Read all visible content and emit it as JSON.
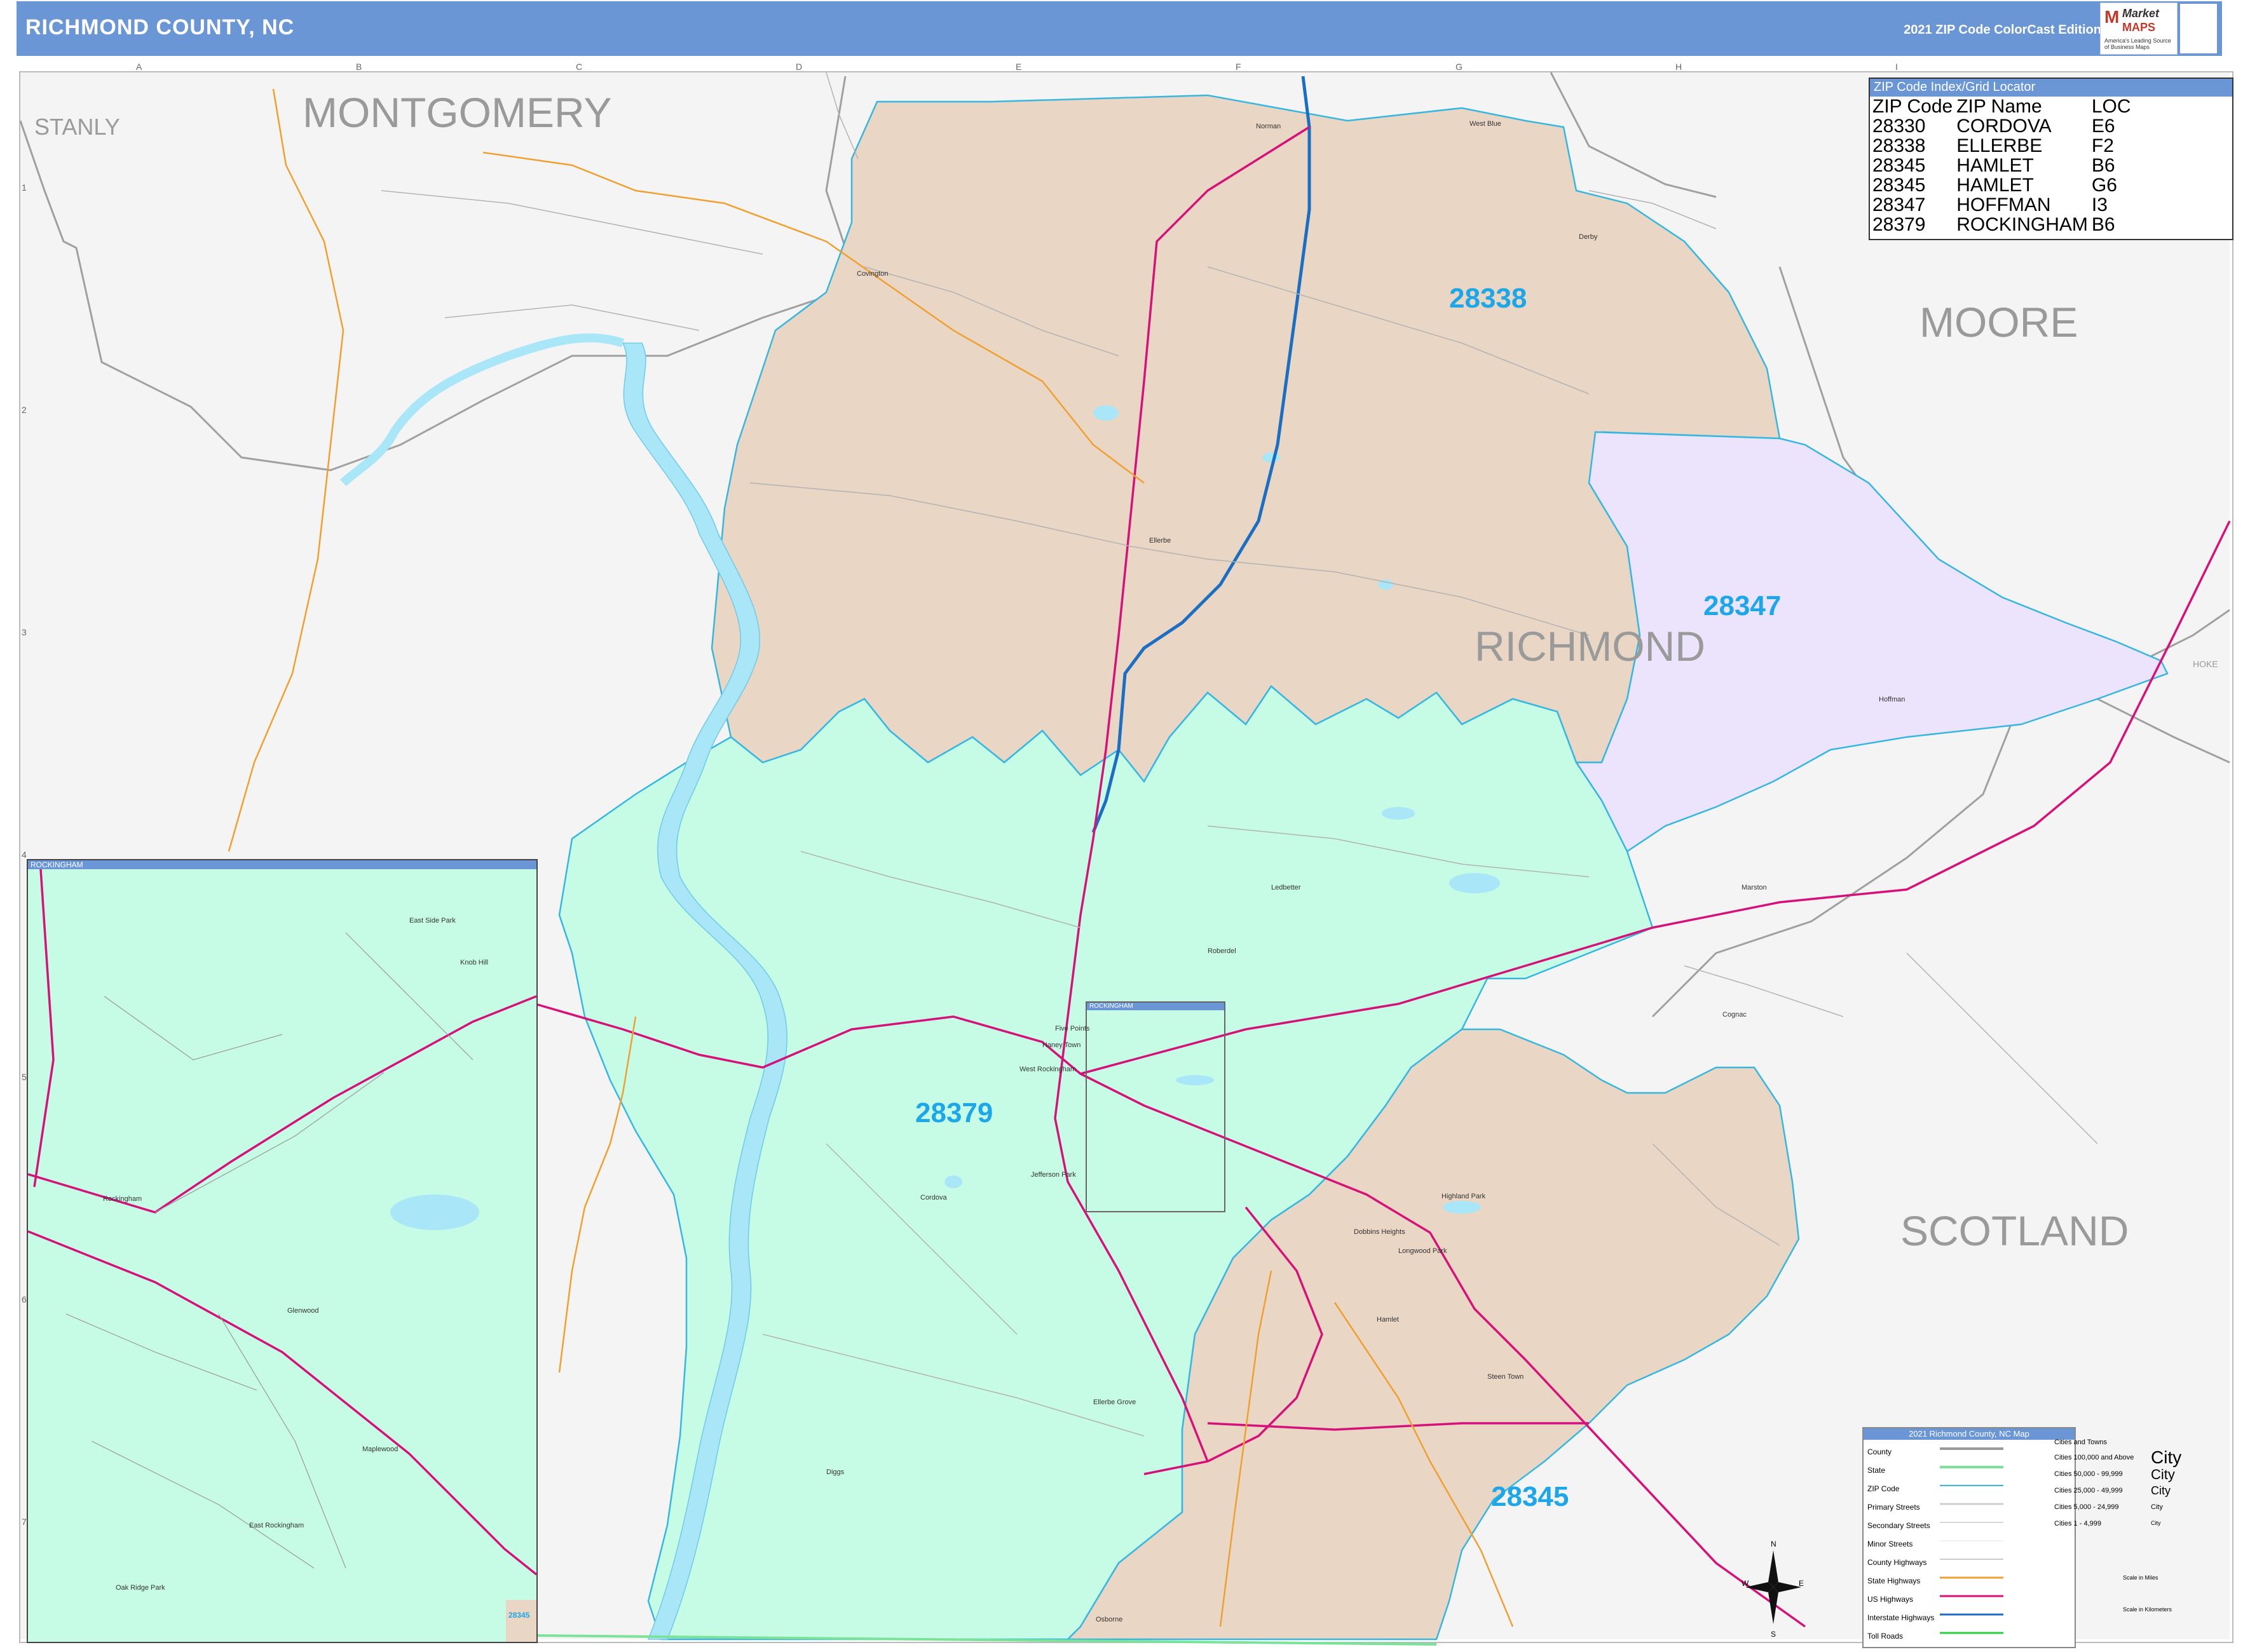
{
  "header": {
    "title": "RICHMOND COUNTY, NC",
    "edition": "2021 ZIP Code ColorCast Edition"
  },
  "logo": {
    "name_market": "Market",
    "name_maps": "MAPS",
    "tagline": "America's Leading Source of Business Maps"
  },
  "counties": {
    "stanly": "STANLY",
    "montgomery": "MONTGOMERY",
    "moore": "MOORE",
    "richmond": "RICHMOND",
    "scotland": "SCOTLAND"
  },
  "zips": {
    "z28338": "28338",
    "z28347": "28347",
    "z28379": "28379",
    "z28345": "28345"
  },
  "colors": {
    "zip_28338": "#e9d6c5",
    "zip_28347": "#ebe4fc",
    "zip_28379": "#c6fbe6",
    "zip_28345": "#e9d6c5",
    "background": "#f4f4f4",
    "zip_border": "#37b7e0",
    "us_highway": "#d6117a",
    "interstate": "#1b6ec2",
    "state_highway": "#f0a030",
    "county_line": "#9a9a9a",
    "water": "#a9e6f7"
  },
  "index": {
    "title": "ZIP Code Index/Grid Locator",
    "columns": [
      "ZIP Code",
      "ZIP Name",
      "LOC"
    ],
    "rows": [
      [
        "28330",
        "CORDOVA",
        "E6"
      ],
      [
        "28338",
        "ELLERBE",
        "F2"
      ],
      [
        "28345",
        "HAMLET",
        "B6"
      ],
      [
        "28345",
        "HAMLET",
        "G6"
      ],
      [
        "28347",
        "HOFFMAN",
        "I3"
      ],
      [
        "28379",
        "ROCKINGHAM",
        "B6"
      ]
    ]
  },
  "grid": {
    "top": [
      "A",
      "B",
      "C",
      "D",
      "E",
      "F",
      "G",
      "H",
      "I"
    ],
    "side": [
      "1",
      "2",
      "3",
      "4",
      "5",
      "6",
      "7"
    ]
  },
  "towns": {
    "norman": "Norman",
    "derby": "Derby",
    "covington": "Covington",
    "ellerbe": "Ellerbe",
    "ledbetter": "Ledbetter",
    "roberdel": "Roberdel",
    "five_points": "Five Points",
    "haney_town": "Haney Town",
    "west_rockingham": "West Rockingham",
    "jefferson_park": "Jefferson Park",
    "cordova": "Cordova",
    "ellerbe_grove": "Ellerbe Grove",
    "diggs": "Diggs",
    "osborne": "Osborne",
    "hoffman": "Hoffman",
    "marston": "Marston",
    "cognac": "Cognac",
    "highland_park": "Highland Park",
    "dobbins_heights": "Dobbins Heights",
    "longwood_park": "Longwood Park",
    "hamlet": "Hamlet",
    "steen_town": "Steen Town",
    "west_blue": "West Blue",
    "hoke": "HOKE"
  },
  "inset": {
    "title": "ROCKINGHAM",
    "towns": {
      "east_side_park": "East Side Park",
      "knob_hill": "Knob Hill",
      "rockingham": "Rockingham",
      "glenwood": "Glenwood",
      "maplewood": "Maplewood",
      "east_rockingham": "East Rockingham",
      "oak_ridge_park": "Oak Ridge Park"
    },
    "zip_edge": "28345"
  },
  "inset_box": {
    "title": "ROCKINGHAM"
  },
  "legend": {
    "title": "2021 Richmond County, NC Map",
    "items": [
      "County",
      "State",
      "ZIP Code",
      "Primary Streets",
      "Secondary Streets",
      "Minor Streets",
      "County Highways",
      "State Highways",
      "US Highways",
      "Interstate Highways",
      "Toll Roads"
    ],
    "cities_title": "Cities and Towns",
    "cities": [
      "Cities 100,000 and Above",
      "Cities 50,000 - 99,999",
      "Cities 25,000 - 49,999",
      "Cities 5,000 - 24,999",
      "Cities 1 - 4,999"
    ],
    "city_samples": [
      "City",
      "City",
      "City",
      "City",
      "City"
    ],
    "scale_miles": "Scale in Miles",
    "scale_km": "Scale in Kilometers"
  },
  "compass": {
    "n": "N",
    "s": "S",
    "e": "E",
    "w": "W"
  }
}
